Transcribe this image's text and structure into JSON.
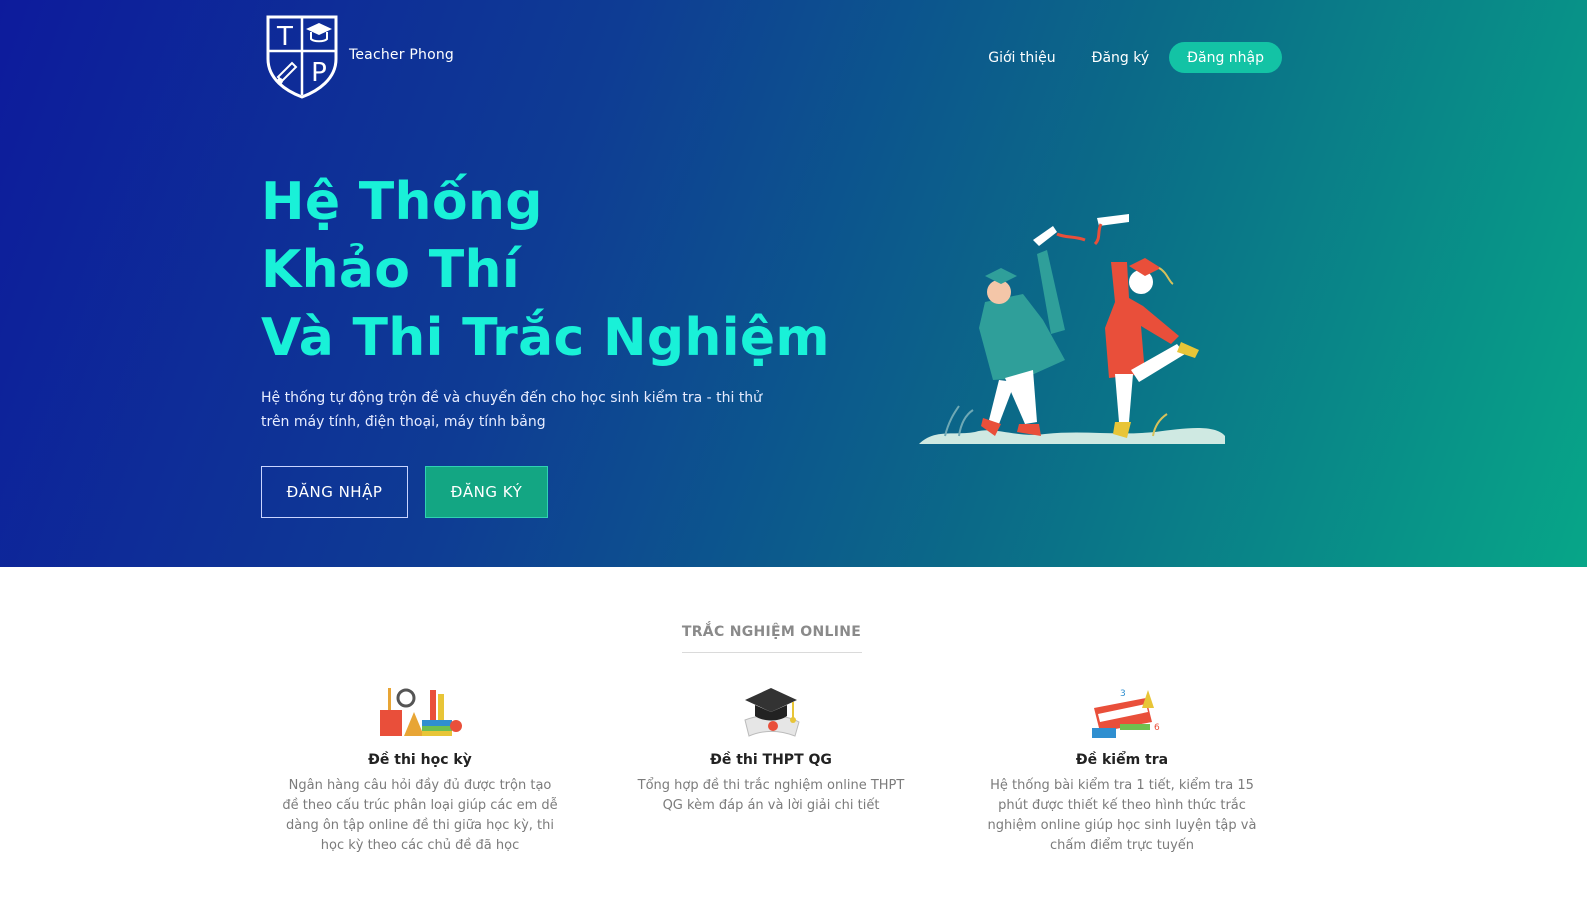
{
  "brand": {
    "name": "Teacher Phong",
    "logo_letters": [
      "T",
      "P"
    ]
  },
  "nav": {
    "items": [
      {
        "label": "Giới thiệu"
      },
      {
        "label": "Đăng ký"
      }
    ],
    "login_label": "Đăng nhập"
  },
  "hero": {
    "title_lines": [
      "Hệ Thống",
      "Khảo Thí",
      "Và Thi Trắc Nghiệm"
    ],
    "subtitle": "Hệ thống tự động trộn đề và chuyển đến cho học sinh kiểm tra - thi thử trên máy tính, điện thoại, máy tính bảng",
    "login_button": "ĐĂNG NHẬP",
    "register_button": "ĐĂNG KÝ"
  },
  "section": {
    "title": "TRẮC NGHIỆM ONLINE",
    "cards": [
      {
        "icon": "school-supplies-icon",
        "title": "Đề thi học kỳ",
        "description": "Ngân hàng câu hỏi đầy đủ được trộn tạo đề theo cấu trúc phân loại giúp các em dễ dàng ôn tập online đề thi giữa học kỳ, thi học kỳ theo các chủ đề đã học"
      },
      {
        "icon": "graduation-cap-icon",
        "title": "Đề thi THPT QG",
        "description": "Tổng hợp đề thi trắc nghiệm online THPT QG kèm đáp án và lời giải chi tiết"
      },
      {
        "icon": "math-book-icon",
        "title": "Đề kiểm tra",
        "description": "Hệ thống bài kiểm tra 1 tiết, kiểm tra 15 phút được thiết kế theo hình thức trắc nghiệm online giúp học sinh luyện tập và chấm điểm trực tuyến"
      }
    ]
  },
  "colors": {
    "hero_gradient_start": "#0d1b9c",
    "hero_gradient_end": "#07a688",
    "headline": "#19f1d8",
    "accent_button": "#13c3a5"
  }
}
